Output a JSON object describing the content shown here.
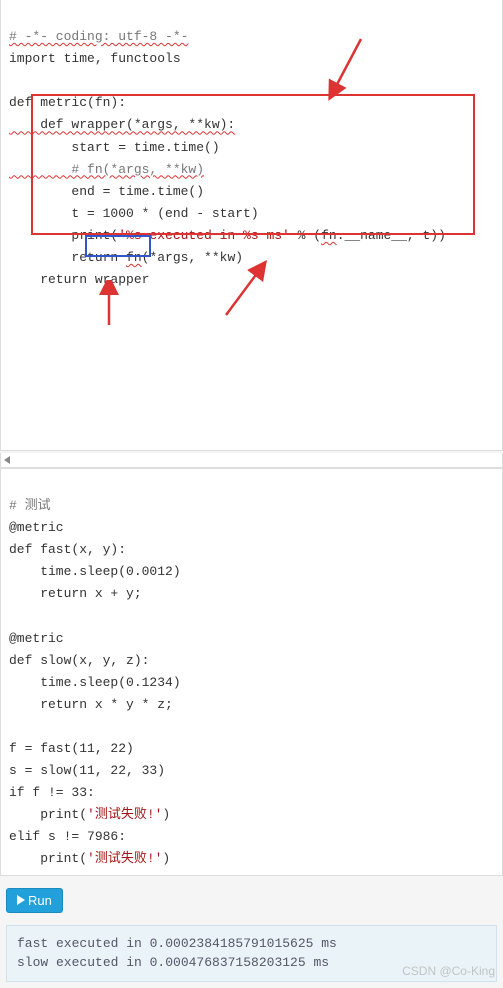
{
  "code1": {
    "l1": "# -*- coding: utf-8 -*-",
    "l2": "import time, functools",
    "l3": "def metric(fn):",
    "l4": "    def wrapper(*args, **kw):",
    "l5": "        start = time.time()",
    "l6": "        # fn(*args, **kw)",
    "l7": "        end = time.time()",
    "l8": "        t = 1000 * (end - start)",
    "l9a": "        print(",
    "l9b": "'%s executed in %s ms'",
    "l9c": " % (",
    "l9d": "fn",
    "l9e": ".__name__, t))",
    "l10a": "        return ",
    "l10b": "fn",
    "l10c": "(*args, **kw)",
    "l11a": "    return ",
    "l11b": "wrapper"
  },
  "code2": {
    "l1": "# 测试",
    "l2": "@metric",
    "l3": "def fast(x, y):",
    "l4": "    time.sleep(0.0012)",
    "l5": "    return x + y;",
    "l6": "@metric",
    "l7": "def slow(x, y, z):",
    "l8": "    time.sleep(0.1234)",
    "l9": "    return x * y * z;",
    "l10": "f = fast(11, 22)",
    "l11": "s = slow(11, 22, 33)",
    "l12": "if f != 33:",
    "l13a": "    print(",
    "l13b": "'测试失败!'",
    "l13c": ")",
    "l14": "elif s != 7986:",
    "l15a": "    print(",
    "l15b": "'测试失败!'",
    "l15c": ")"
  },
  "run_label": "Run",
  "output": {
    "o1": "fast executed in 0.0002384185791015625 ms",
    "o2": "slow executed in 0.000476837158203125 ms"
  },
  "watermark": "CSDN @Co-King"
}
